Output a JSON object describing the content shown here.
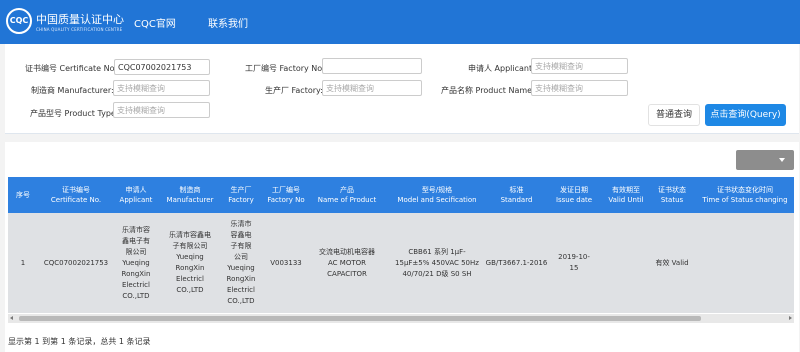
{
  "header": {
    "logo_badge": "CQC",
    "logo_text": "中国质量认证中心",
    "logo_subtext": "CHINA QUALITY CERTIFICATION CENTRE",
    "nav": [
      "CQC官网",
      "联系我们"
    ]
  },
  "search": {
    "fields": [
      {
        "label": "证书编号 Certificate No.:",
        "value": "CQC07002021753",
        "placeholder": ""
      },
      {
        "label": "工厂编号 Factory No.:",
        "value": "",
        "placeholder": ""
      },
      {
        "label": "申请人 Applicant:",
        "value": "",
        "placeholder": "支持模糊查询"
      },
      {
        "label": "制造商 Manufacturer:",
        "value": "",
        "placeholder": "支持模糊查询"
      },
      {
        "label": "生产厂 Factory:",
        "value": "",
        "placeholder": "支持模糊查询"
      },
      {
        "label": "产品名称 Product Name:",
        "value": "",
        "placeholder": "支持模糊查询"
      },
      {
        "label": "产品型号 Product Type:",
        "value": "",
        "placeholder": "支持模糊查询"
      }
    ],
    "buttons": {
      "normal": "普通查询",
      "primary": "点击查询(Query)"
    }
  },
  "table": {
    "columns": [
      [
        "序号"
      ],
      [
        "证书编号",
        "Certificate No."
      ],
      [
        "申请人",
        "Applicant"
      ],
      [
        "制造商",
        "Manufacturer"
      ],
      [
        "生产厂",
        "Factory"
      ],
      [
        "工厂编号",
        "Factory No"
      ],
      [
        "产品",
        "Name of Product"
      ],
      [
        "型号/规格",
        "Model and Secification"
      ],
      [
        "标准",
        "Standard"
      ],
      [
        "发证日期",
        "Issue date"
      ],
      [
        "有效期至",
        "Valid Until"
      ],
      [
        "证书状态",
        "Status"
      ],
      [
        "证书状态变化时间",
        "Time of Status changing"
      ]
    ],
    "rows": [
      [
        [
          "1"
        ],
        [
          "CQC07002021753"
        ],
        [
          "乐清市容",
          "鑫电子有",
          "限公司",
          "Yueqing",
          "RongXin",
          "Electricl",
          "CO.,LTD"
        ],
        [
          "乐清市容鑫电",
          "子有限公司",
          "Yueqing",
          "RongXin",
          "Electricl",
          "CO.,LTD"
        ],
        [
          "乐清市",
          "容鑫电",
          "子有限",
          "公司",
          "Yueqing",
          "RongXin",
          "Electricl",
          "CO.,LTD"
        ],
        [
          "V003133"
        ],
        [
          "交流电动机电容器",
          "AC MOTOR",
          "CAPACITOR"
        ],
        [
          "CBB61 系列 1μF-",
          "15μF±5% 450VAC 50Hz",
          "40/70/21 D级 S0 SH"
        ],
        [
          "GB/T3667.1-2016"
        ],
        [
          "2019-10-",
          "15"
        ],
        [
          ""
        ],
        [
          "有效 Valid"
        ],
        [
          ""
        ]
      ]
    ]
  },
  "pagination": {
    "info": "显示第 1 到第 1 条记录，总共 1 条记录"
  }
}
